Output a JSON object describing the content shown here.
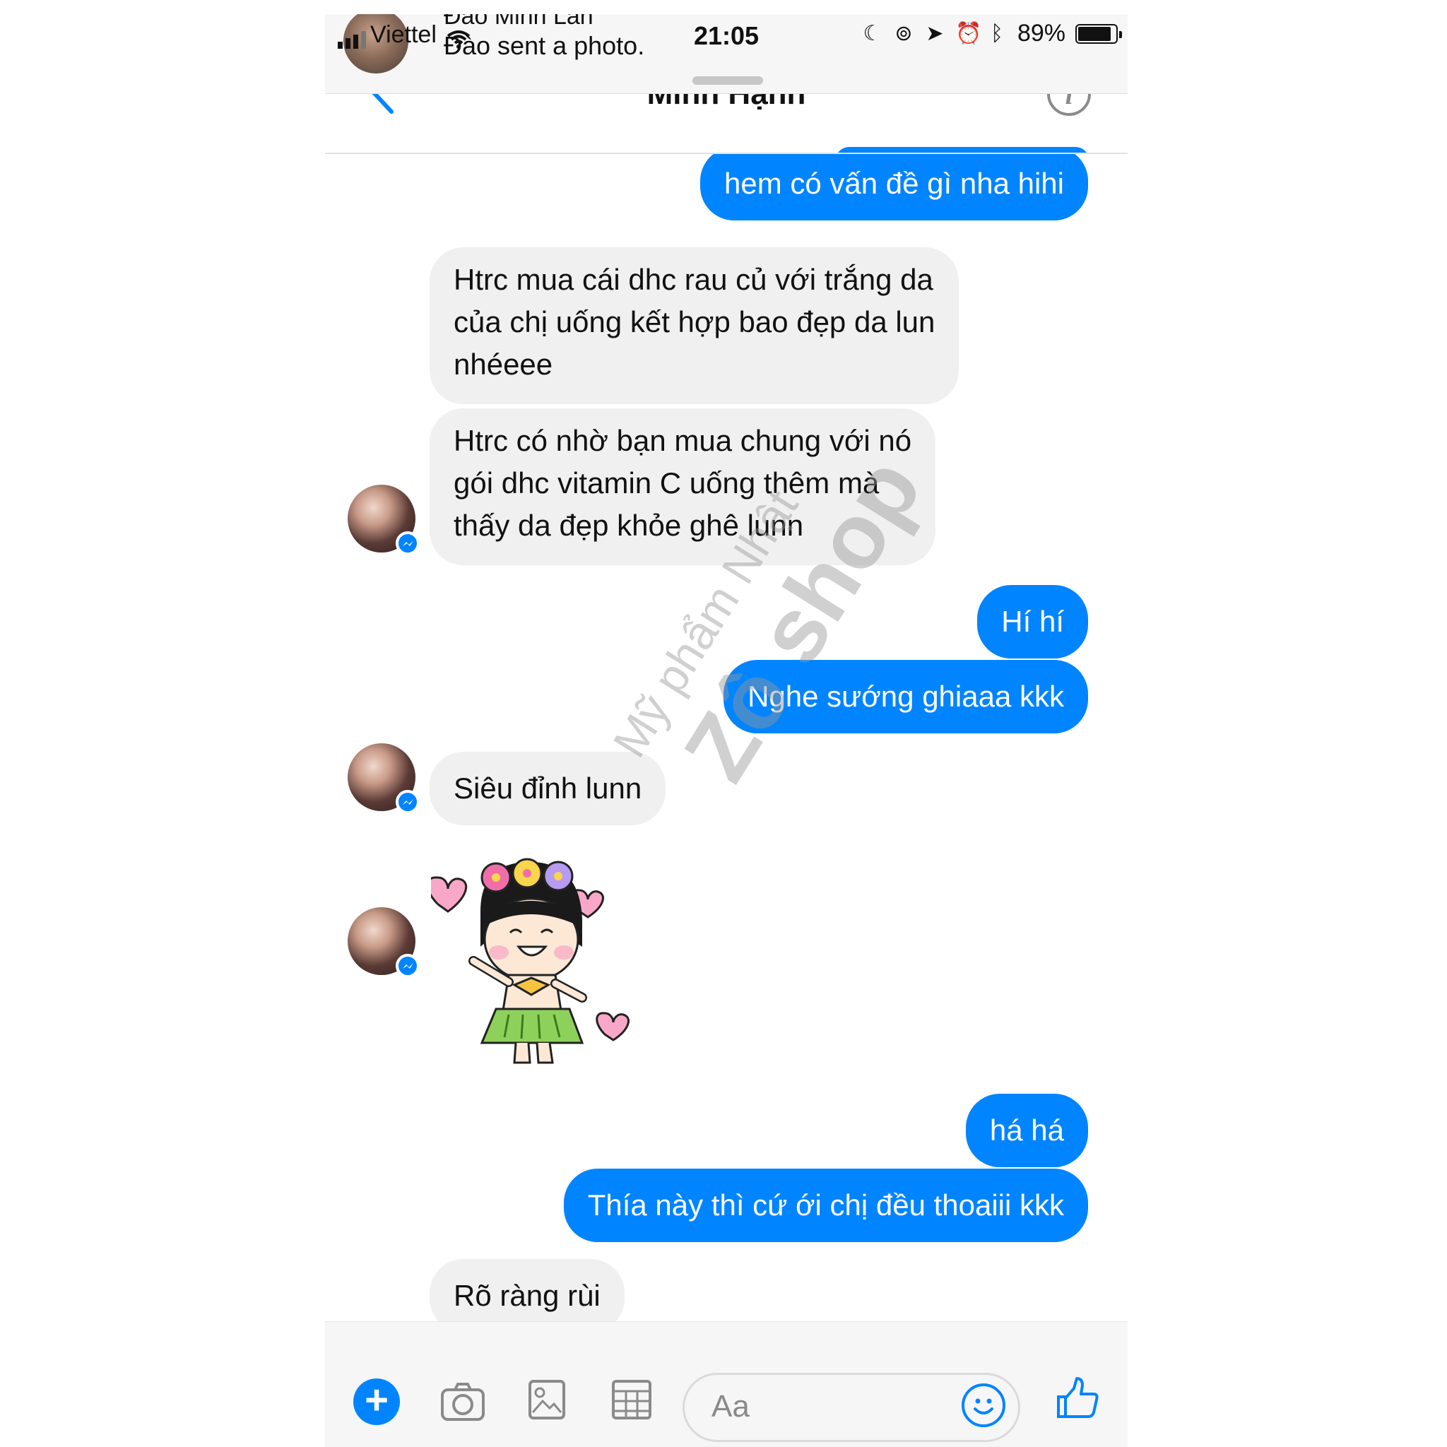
{
  "notification": {
    "sender": "Đào Minh Lan",
    "message": "Đào sent a photo."
  },
  "status_bar": {
    "carrier": "Viettel",
    "time": "21:05",
    "battery": "89%",
    "battery_level": 0.89
  },
  "header": {
    "title": "Minh Hạnh"
  },
  "messages": {
    "m1": "hem có vấn đề gì nha  hihi",
    "m2_l1": "Htrc mua cái dhc rau củ với trắng da",
    "m2_l2": "của chị uống kết hợp bao đẹp da lun",
    "m2_l3": "nhéeee",
    "m3_l1": "Htrc có nhờ bạn mua chung với nó",
    "m3_l2": "gói dhc vitamin C uống thêm mà",
    "m3_l3": "thấy da đẹp khỏe ghê lunn",
    "m4": "Hí hí",
    "m5": "Nghe sướng ghiaaa kkk",
    "m6": "Siêu đỉnh lunn",
    "m8": "há há",
    "m9": "Thía này thì cứ ới chị đều thoaiii kkk",
    "m10": "Rõ ràng rùi"
  },
  "watermark": {
    "line1": "Mỹ phẩm Nhật",
    "line2": "Zô shop"
  },
  "composer": {
    "placeholder": "Aa"
  },
  "colors": {
    "sent_bubble": "#0084ff",
    "received_bubble": "#f1f0f0",
    "accent": "#0084ff"
  }
}
